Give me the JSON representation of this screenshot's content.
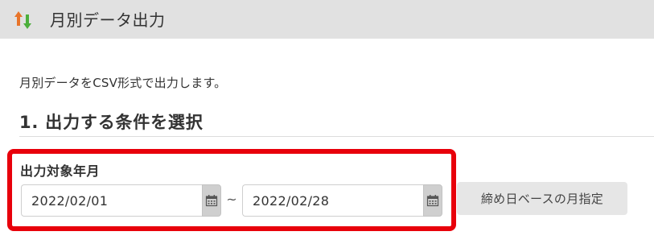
{
  "header": {
    "title": "月別データ出力",
    "icon": "sort-arrows-icon",
    "icon_colors": {
      "up_arrow": "#e8742a",
      "down_arrow": "#4caf3c"
    }
  },
  "main": {
    "description": "月別データをCSV形式で出力します。",
    "section_heading": "1. 出力する条件を選択",
    "target_period": {
      "label": "出力対象年月",
      "start_date": "2022/02/01",
      "separator": "~",
      "end_date": "2022/02/28",
      "calendar_icon": "calendar-icon",
      "highlight_color": "#e8000b"
    },
    "closing_day_button_label": "締め日ベースの月指定"
  }
}
